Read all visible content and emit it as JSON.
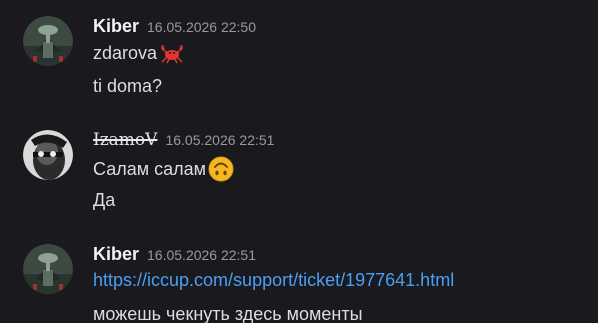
{
  "messages": [
    {
      "author": "Kiber",
      "timestamp": "16.05.2026 22:50",
      "lines": [
        "zdarova",
        "ti doma?"
      ],
      "emoji": "crab-emoji"
    },
    {
      "author": "IzamoV",
      "timestamp": "16.05.2026 22:51",
      "lines": [
        "Салам салам",
        "Да"
      ],
      "emoji": "upside-down-face-emoji"
    },
    {
      "author": "Kiber",
      "timestamp": "16.05.2026 22:51",
      "link": "https://iccup.com/support/ticket/1977641.html",
      "lines": [
        "можешь чекнуть здесь моменты"
      ]
    }
  ],
  "colors": {
    "background": "#1a1a1e",
    "author": "#f2f3f5",
    "timestamp": "#949ba4",
    "message_text": "#dbdee1",
    "link": "#4a9ff5"
  }
}
